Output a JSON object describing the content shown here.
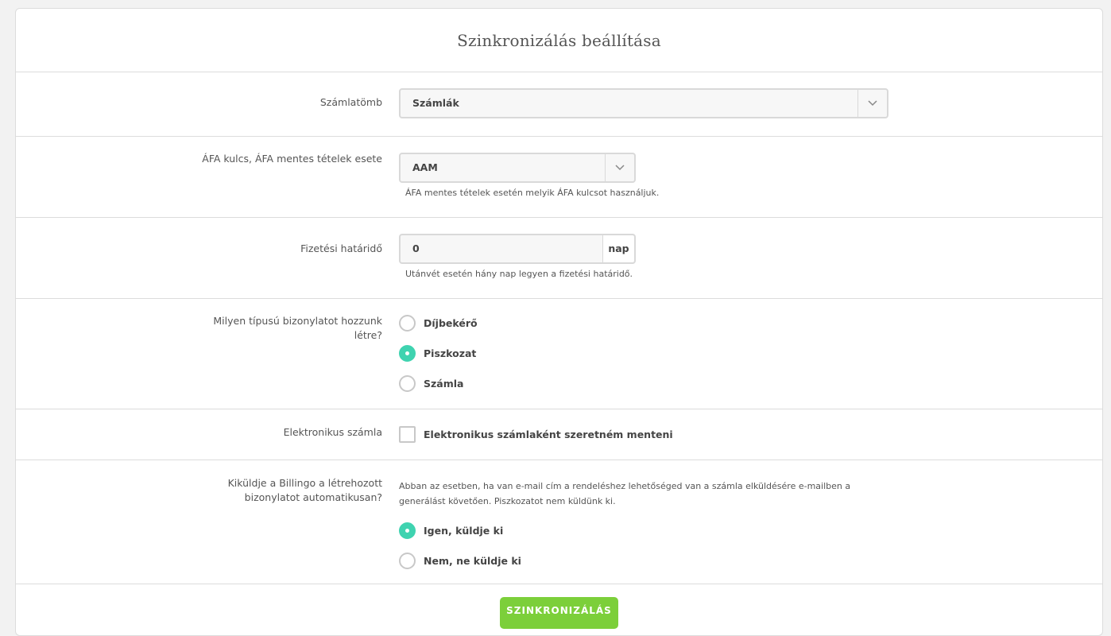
{
  "title": "Szinkronizálás beállítása",
  "invoice_block": {
    "label": "Számlatömb",
    "value": "Számlák"
  },
  "vat": {
    "label": "ÁFA kulcs, ÁFA mentes tételek esete",
    "value": "AAM",
    "help": "ÁFA mentes tételek esetén melyik ÁFA kulcsot használjuk."
  },
  "deadline": {
    "label": "Fizetési határidő",
    "value": "0",
    "unit": "nap",
    "help": "Utánvét esetén hány nap legyen a fizetési határidő."
  },
  "doc_type": {
    "label": "Milyen típusú bizonylatot hozzunk létre?",
    "options": [
      {
        "label": "Díjbekérő",
        "checked": false
      },
      {
        "label": "Piszkozat",
        "checked": true
      },
      {
        "label": "Számla",
        "checked": false
      }
    ]
  },
  "einvoice": {
    "label": "Elektronikus számla",
    "checkbox_label": "Elektronikus számlaként szeretném menteni",
    "checked": false
  },
  "send": {
    "label": "Kiküldje a Billingo a létrehozott bizonylatot automatikusan?",
    "description": "Abban az esetben, ha van e-mail cím a rendeléshez lehetőséged van a számla elküldésére e-mailben a generálást követően. Piszkozatot nem küldünk ki.",
    "options": [
      {
        "label": "Igen, küldje ki",
        "checked": true
      },
      {
        "label": "Nem, ne küldje ki",
        "checked": false
      }
    ]
  },
  "submit_label": "SZINKRONIZÁLÁS",
  "colors": {
    "accent": "#3fd3b0",
    "button": "#7ccf3a",
    "border": "#dcdcdc"
  }
}
